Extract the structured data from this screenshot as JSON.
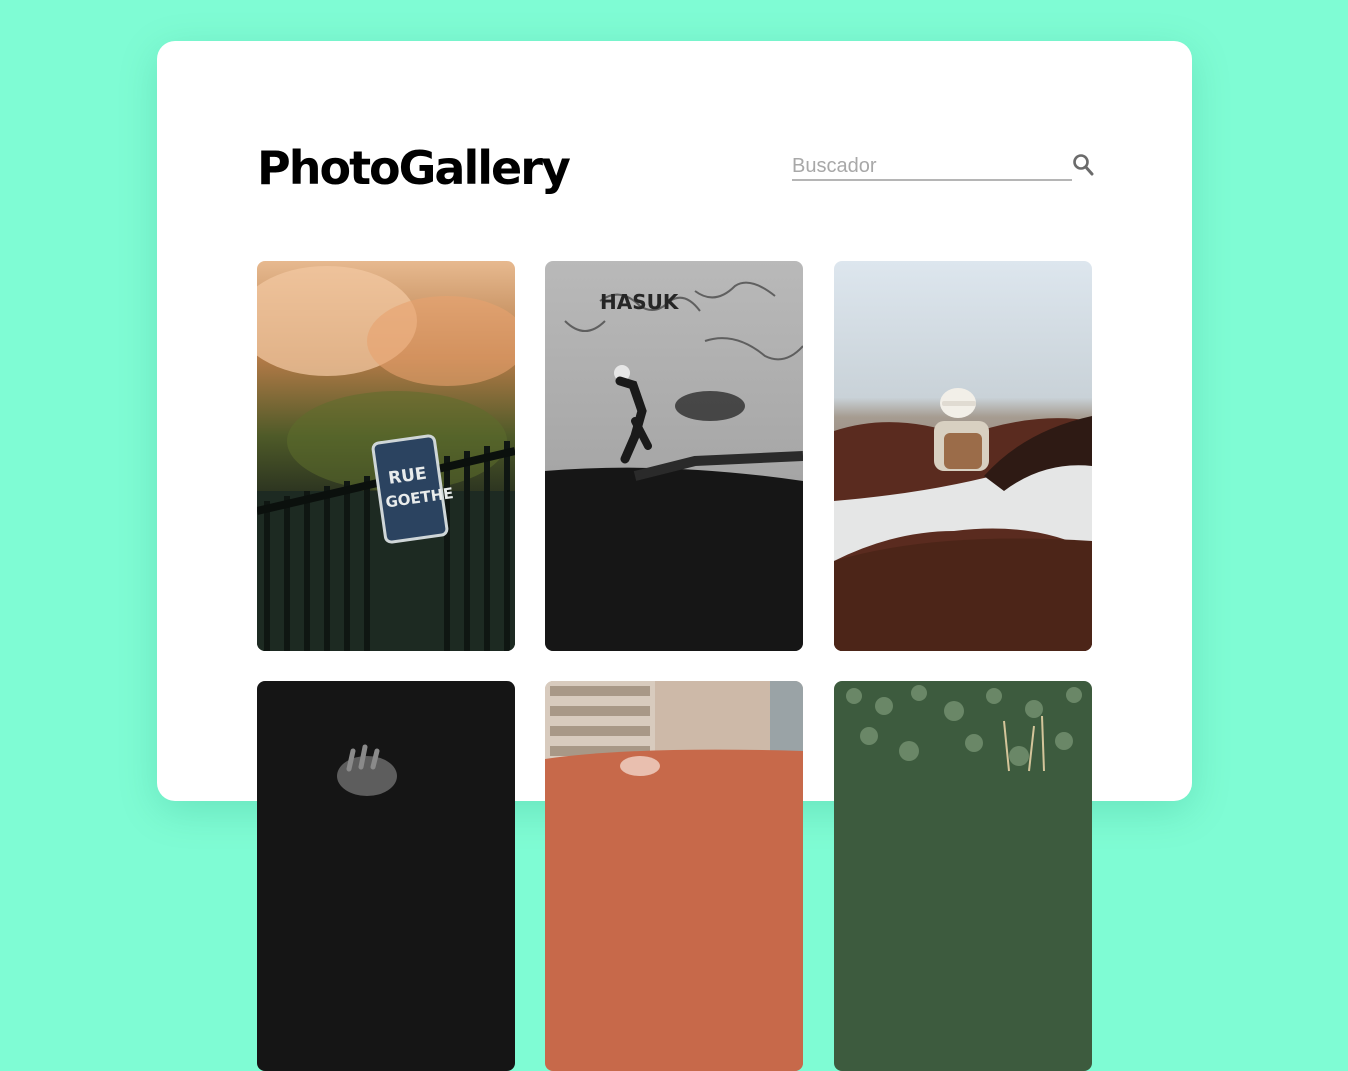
{
  "header": {
    "logo": "PhotoGallery"
  },
  "search": {
    "placeholder": "Buscador",
    "value": "",
    "icon": "search-icon"
  },
  "gallery": {
    "photos": [
      {
        "subject": "street-sign-fence"
      },
      {
        "subject": "skateboarder-bw"
      },
      {
        "subject": "horses-rider"
      },
      {
        "subject": "dark-hand"
      },
      {
        "subject": "building-car"
      },
      {
        "subject": "field-plants"
      }
    ]
  },
  "colors": {
    "background": "#7ffcd4",
    "card": "#ffffff",
    "text": "#000000",
    "placeholder": "#a8a8a8"
  }
}
